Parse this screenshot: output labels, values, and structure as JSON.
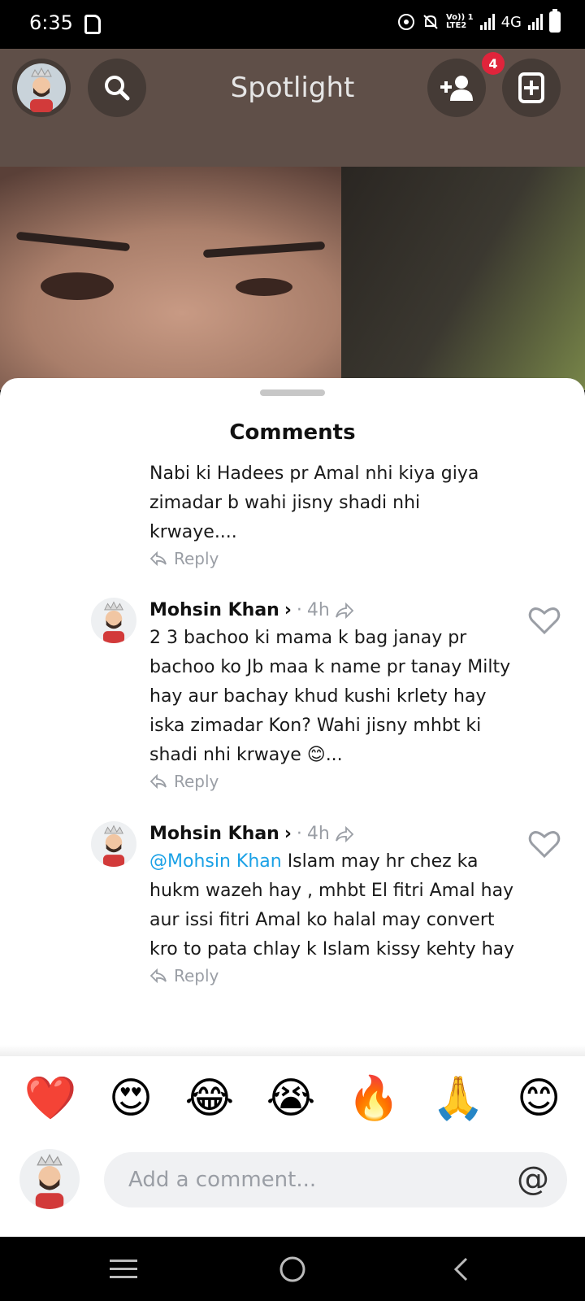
{
  "status_bar": {
    "time": "6:35",
    "network": "4G",
    "lte_label_1": "Vo)) 1",
    "lte_label_2": "LTE2"
  },
  "header": {
    "title": "Spotlight",
    "friend_requests_badge": "4"
  },
  "sheet": {
    "title": "Comments"
  },
  "first_comment": {
    "text": "Nabi ki Hadees pr Amal nhi kiya giya zimadar b wahi jisny shadi nhi krwaye....",
    "reply_label": "Reply"
  },
  "comments": [
    {
      "author": "Mohsin Khan",
      "time": "4h",
      "text": "2 3 bachoo ki mama k bag janay pr bachoo ko Jb maa k name pr tanay Milty hay aur bachay khud kushi krlety hay iska zimadar Kon? Wahi jisny mhbt ki shadi nhi krwaye 😊...",
      "reply_label": "Reply"
    },
    {
      "author": "Mohsin Khan",
      "time": "4h",
      "mention": "@Mohsin Khan",
      "text": " Islam may hr chez ka hukm wazeh hay , mhbt El fitri Amal hay aur issi fitri Amal ko halal may convert kro to pata chlay k Islam kissy kehty hay",
      "reply_label": "Reply"
    }
  ],
  "emoji_bar": [
    "❤️",
    "😍",
    "😂",
    "😭",
    "🔥",
    "🙏",
    "😊"
  ],
  "composer": {
    "placeholder": "Add a comment...",
    "at_symbol": "@"
  },
  "colors": {
    "accent_mention": "#1aa1e6",
    "badge": "#e0243b",
    "muted": "#9a9ea5"
  }
}
